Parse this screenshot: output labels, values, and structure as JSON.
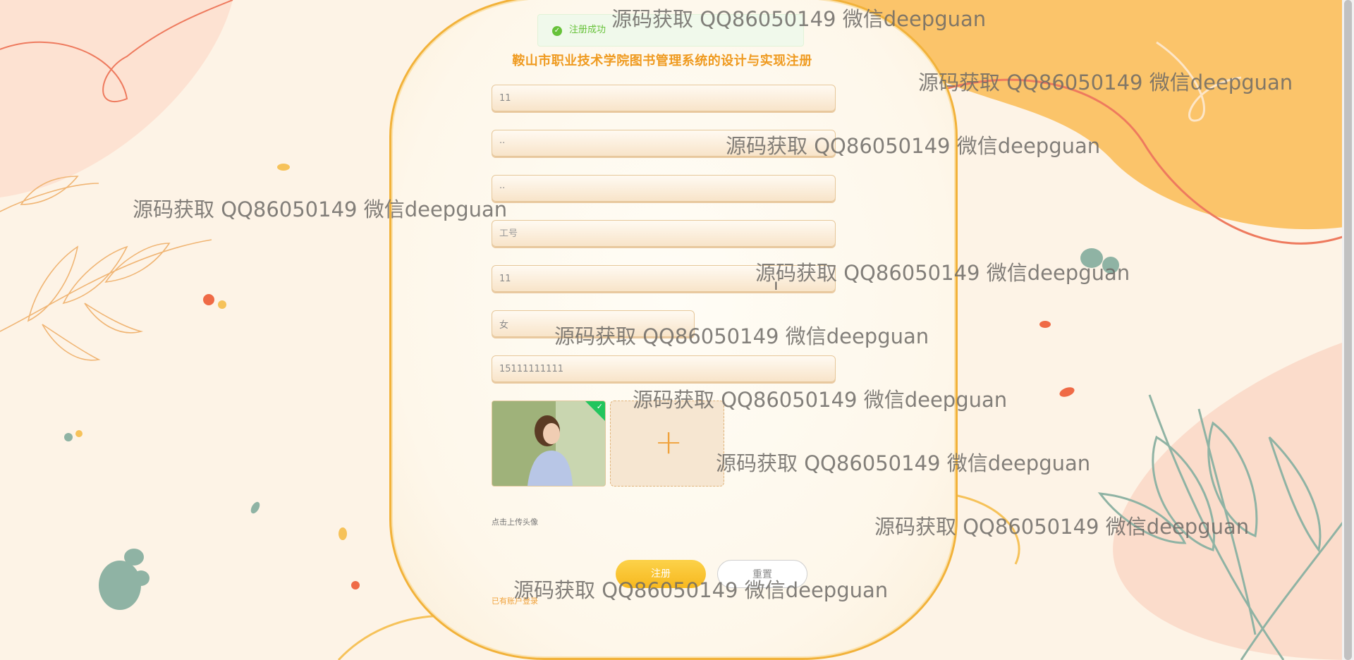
{
  "page": {
    "title": "鞍山市职业技术学院图书管理系统的设计与实现注册"
  },
  "toast": {
    "message": "注册成功",
    "icon": "check-circle-icon",
    "color": "#67c23a"
  },
  "form": {
    "fields": [
      {
        "name": "account",
        "value": "11",
        "placeholder": ""
      },
      {
        "name": "password",
        "value": "··",
        "placeholder": ""
      },
      {
        "name": "confirm-password",
        "value": "··",
        "placeholder": ""
      },
      {
        "name": "employee-no",
        "value": "",
        "placeholder": "工号"
      },
      {
        "name": "name",
        "value": "11",
        "placeholder": ""
      },
      {
        "name": "gender",
        "value": "女",
        "placeholder": ""
      },
      {
        "name": "phone",
        "value": "15111111111",
        "placeholder": ""
      }
    ],
    "upload_hint": "点击上传头像",
    "upload_add_icon": "plus-icon",
    "register_button": "注册",
    "reset_button": "重置",
    "login_link": "已有账户登录"
  },
  "watermark": {
    "text": "源码获取 QQ86050149 微信deepguan"
  },
  "colors": {
    "accent": "#ef9a1f",
    "primary_button": "#f7b81e",
    "success": "#67c23a"
  }
}
